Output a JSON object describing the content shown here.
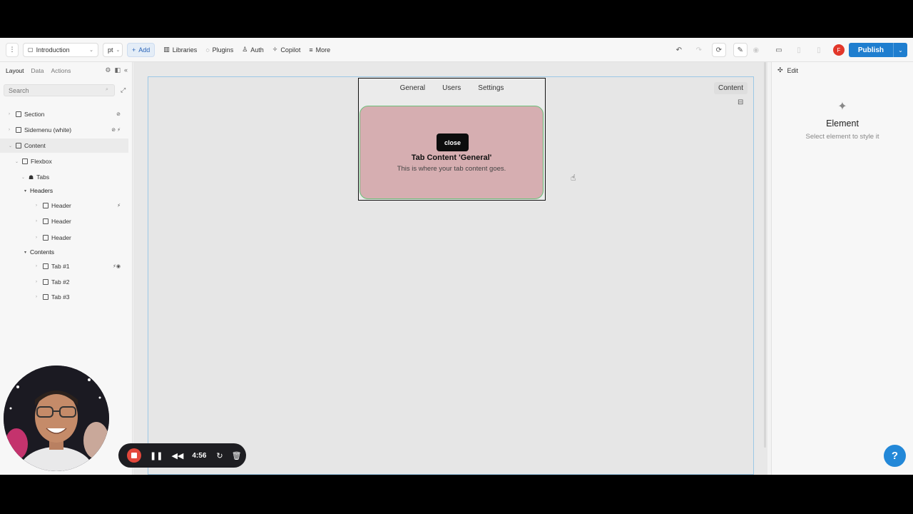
{
  "toolbar": {
    "page_select": "Introduction",
    "lang_select": "pt",
    "add_label": "Add",
    "libraries_label": "Libraries",
    "plugins_label": "Plugins",
    "auth_label": "Auth",
    "copilot_label": "Copilot",
    "more_label": "More",
    "user_initial": "F",
    "publish_label": "Publish"
  },
  "left_panel": {
    "tabs": [
      "Layout",
      "Data",
      "Actions"
    ],
    "search_placeholder": "Search",
    "tree": [
      {
        "label": "Section"
      },
      {
        "label": "Sidemenu (white)"
      },
      {
        "label": "Content"
      },
      {
        "label": "Flexbox"
      },
      {
        "label": "Tabs"
      },
      {
        "label": "Headers"
      },
      {
        "label": "Header"
      },
      {
        "label": "Header"
      },
      {
        "label": "Header"
      },
      {
        "label": "Contents"
      },
      {
        "label": "Tab #1"
      },
      {
        "label": "Tab #2"
      },
      {
        "label": "Tab #3"
      }
    ]
  },
  "canvas": {
    "tab_headers": [
      "General",
      "Users",
      "Settings"
    ],
    "close_label": "close",
    "tab_title": "Tab Content 'General'",
    "tab_description": "This is where your tab content goes.",
    "content_label": "Content"
  },
  "right_panel": {
    "edit_label": "Edit",
    "empty_title": "Element",
    "empty_subtitle": "Select element to style it"
  },
  "recorder": {
    "time": "4:56"
  },
  "colors": {
    "accent": "#1f7ecf",
    "tab_content_bg": "#d6aeb1",
    "tab_content_border": "#6cc07a",
    "record": "#e3473b"
  }
}
